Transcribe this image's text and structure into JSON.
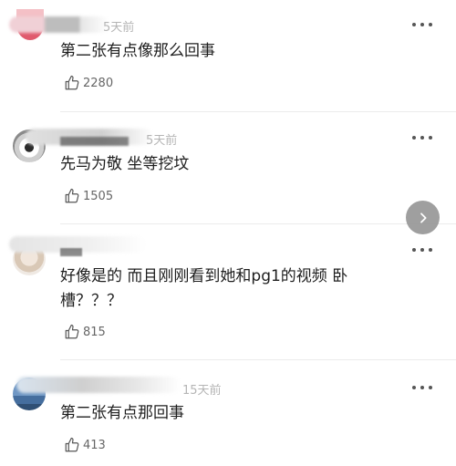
{
  "comments": [
    {
      "time": "5天前",
      "text": "第二张有点像那么回事",
      "likes": "2280"
    },
    {
      "time": "5天前",
      "text": "先马为敬 坐等挖坟",
      "likes": "1505"
    },
    {
      "time": "",
      "text": "好像是的 而且刚刚看到她和pg1的视频 卧槽？？？",
      "likes": "815"
    },
    {
      "time": "15天前",
      "text": "第二张有点那回事",
      "likes": "413"
    }
  ],
  "icons": {
    "more": "more-dots-icon",
    "like": "thumbs-up-icon",
    "next": "chevron-right-icon"
  },
  "colors": {
    "text": "#1e1e1e",
    "time": "#b5b5b5",
    "count": "#666666",
    "next_button": "#9a9a9a"
  }
}
